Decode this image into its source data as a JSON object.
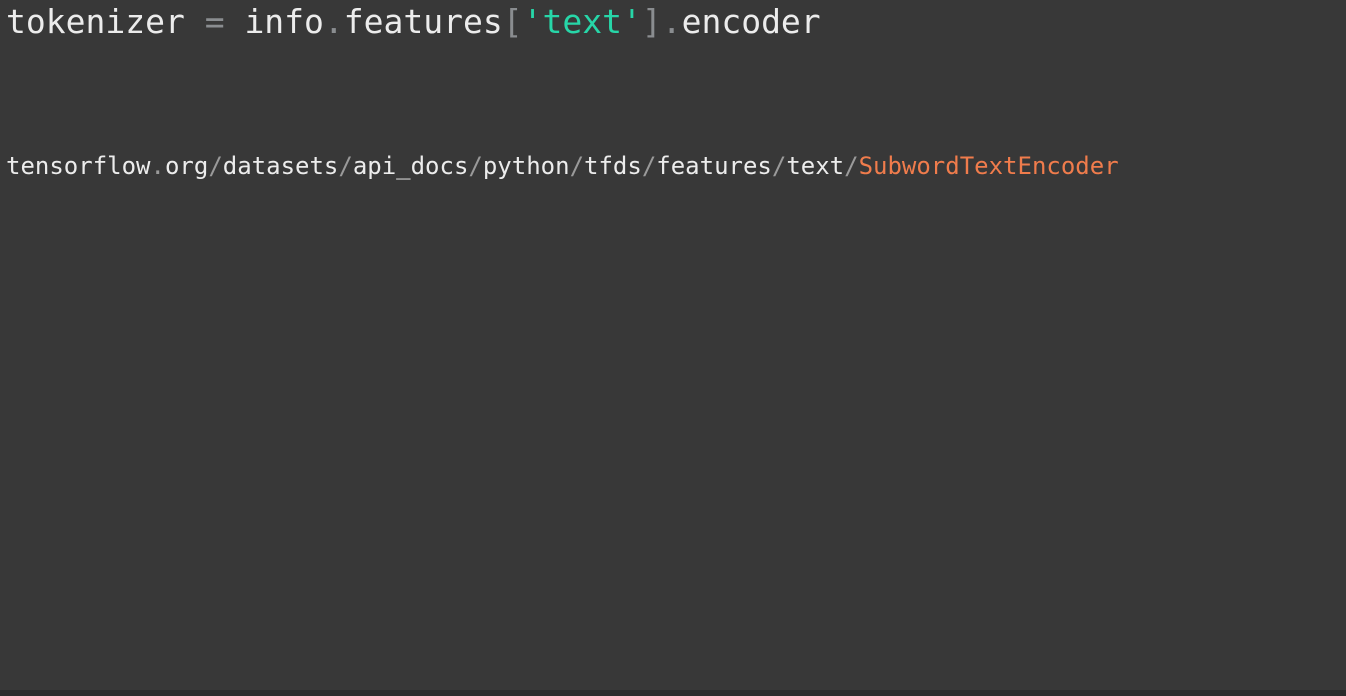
{
  "code": {
    "var": "tokenizer",
    "space1": " ",
    "eq": "=",
    "space2": " ",
    "obj": "info",
    "dot1": ".",
    "attr": "features",
    "lbracket": "[",
    "string": "'text'",
    "rbracket": "]",
    "dot2": ".",
    "method": "encoder"
  },
  "url": {
    "parts": [
      {
        "text": "tensorflow",
        "kind": "text"
      },
      {
        "text": ".",
        "kind": "sep"
      },
      {
        "text": "org",
        "kind": "text"
      },
      {
        "text": "/",
        "kind": "sep"
      },
      {
        "text": "datasets",
        "kind": "text"
      },
      {
        "text": "/",
        "kind": "sep"
      },
      {
        "text": "api_docs",
        "kind": "text"
      },
      {
        "text": "/",
        "kind": "sep"
      },
      {
        "text": "python",
        "kind": "text"
      },
      {
        "text": "/",
        "kind": "sep"
      },
      {
        "text": "tfds",
        "kind": "text"
      },
      {
        "text": "/",
        "kind": "sep"
      },
      {
        "text": "features",
        "kind": "text"
      },
      {
        "text": "/",
        "kind": "sep"
      },
      {
        "text": "text",
        "kind": "text"
      },
      {
        "text": "/",
        "kind": "sep"
      },
      {
        "text": "SubwordTextEncoder",
        "kind": "highlight"
      }
    ]
  },
  "colors": {
    "background": "#383838",
    "text": "#ececec",
    "punctuation": "#8a8d90",
    "string": "#27d6a8",
    "highlight": "#f07c4c"
  }
}
